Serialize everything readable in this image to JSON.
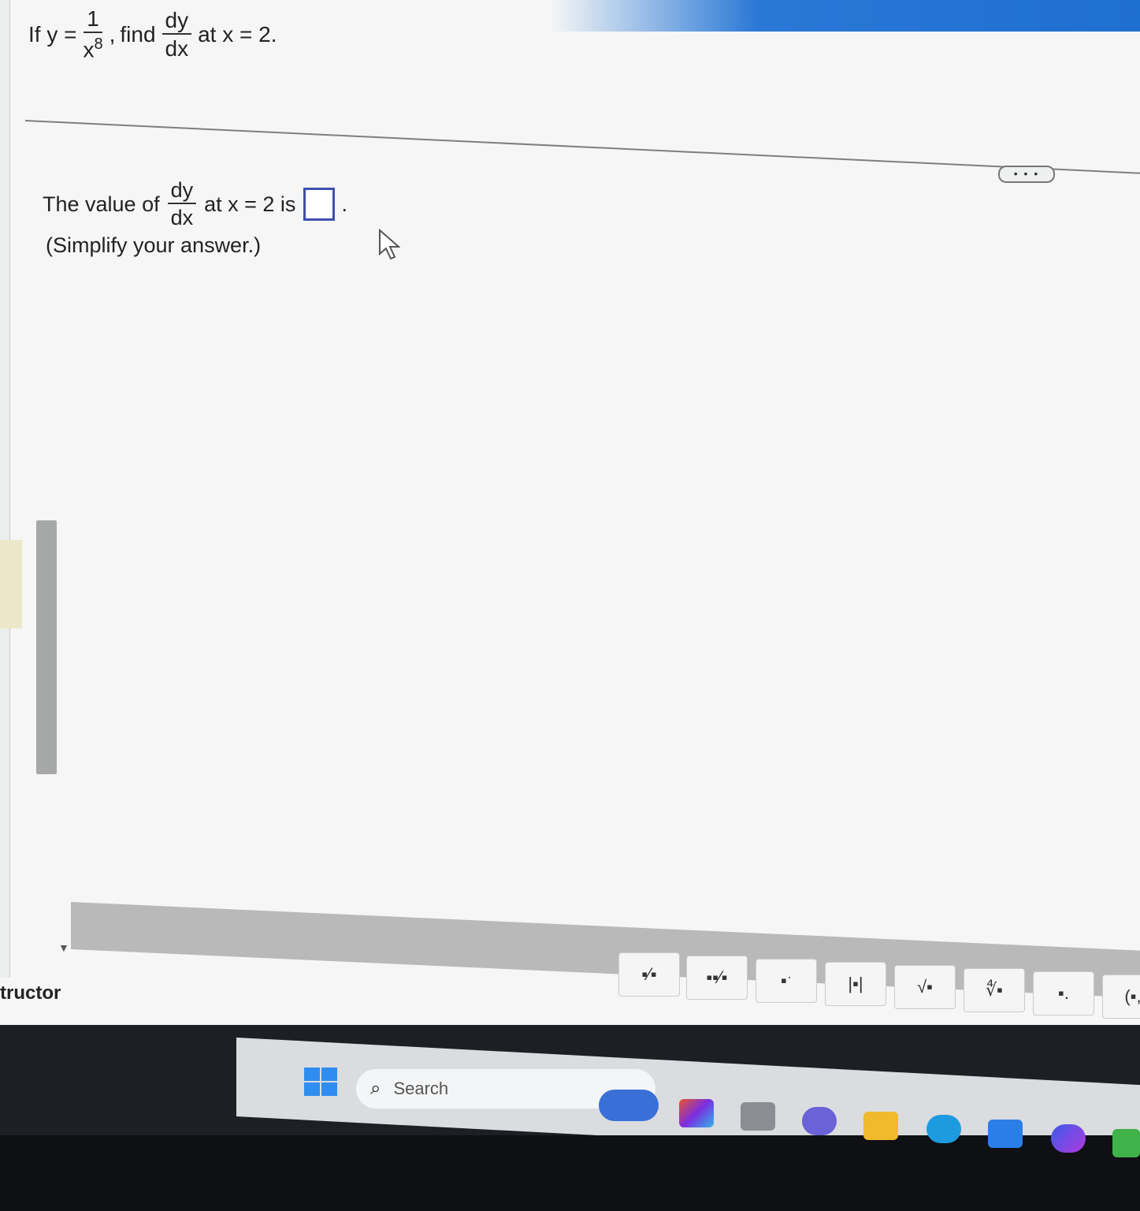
{
  "question": {
    "prefix": "If y =",
    "numerator": "1",
    "den_base": "x",
    "den_exp": "8",
    "comma": ",",
    "find": "find",
    "deriv_num": "dy",
    "deriv_den": "dx",
    "suffix": "at x = 2."
  },
  "more_button": "• • •",
  "answer": {
    "prefix": "The value of",
    "deriv_num": "dy",
    "deriv_den": "dx",
    "suffix": "at x = 2 is",
    "period": ".",
    "hint": "(Simplify your answer.)"
  },
  "palette": [
    {
      "icon": "fraction-icon",
      "glyph": "▪⁄▪"
    },
    {
      "icon": "mixed-number-icon",
      "glyph": "▪▪⁄▪"
    },
    {
      "icon": "exponent-icon",
      "glyph": "▪ˑ"
    },
    {
      "icon": "absolute-value-icon",
      "glyph": "|▪|"
    },
    {
      "icon": "square-root-icon",
      "glyph": "√▪"
    },
    {
      "icon": "nth-root-icon",
      "glyph": "∜▪"
    },
    {
      "icon": "decimal-icon",
      "glyph": "▪."
    },
    {
      "icon": "ordered-pair-icon",
      "glyph": "(▪,"
    }
  ],
  "sidebar_label": "tructor",
  "taskbar": {
    "search_placeholder": "Search"
  },
  "colors": {
    "accent_blue": "#2a78d6",
    "answer_box_border": "#3f4fb0"
  }
}
